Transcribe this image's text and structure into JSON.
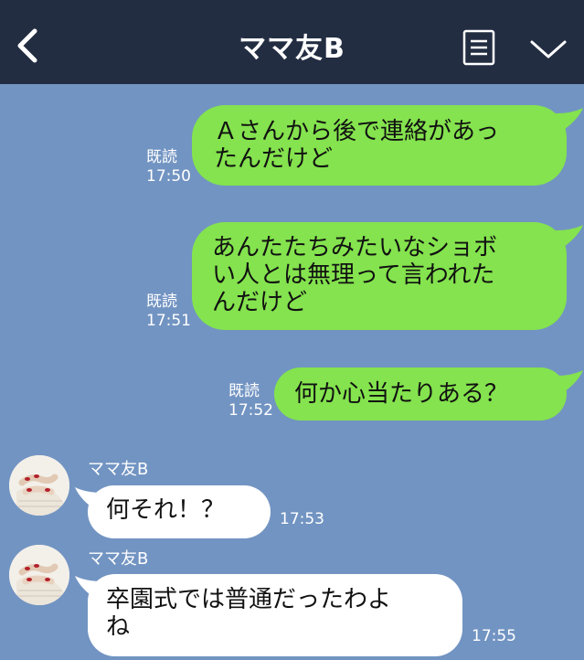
{
  "header": {
    "title": "ママ友B",
    "back_icon": "chevron-left-icon",
    "menu_icon": "menu-icon",
    "collapse_icon": "chevron-down-icon"
  },
  "colors": {
    "header_bg": "#232d42",
    "chat_bg": "#7294c2",
    "sent_bubble": "#84e34e",
    "received_bubble": "#ffffff"
  },
  "messages": [
    {
      "direction": "sent",
      "read_label": "既読",
      "time": "17:50",
      "text": "Ａさんから後で連絡があっ\nたんだけど"
    },
    {
      "direction": "sent",
      "read_label": "既読",
      "time": "17:51",
      "text": "あんたたちみたいなショボ\nい人とは無理って言われた\nんだけど"
    },
    {
      "direction": "sent",
      "read_label": "既読",
      "time": "17:52",
      "text": "何か心当たりある？"
    },
    {
      "direction": "received",
      "sender": "ママ友B",
      "time": "17:53",
      "text": "何それ！？"
    },
    {
      "direction": "received",
      "sender": "ママ友B",
      "time": "17:55",
      "text": "卒園式では普通だったわよ\nね"
    }
  ]
}
